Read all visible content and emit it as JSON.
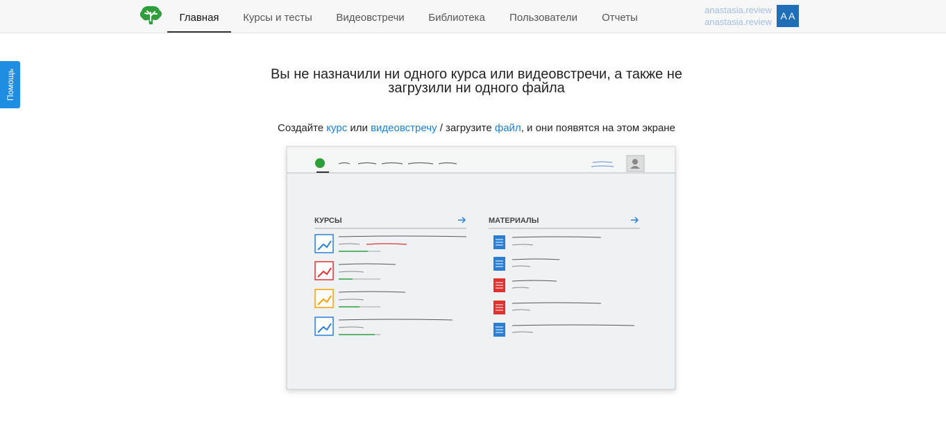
{
  "nav": {
    "items": [
      {
        "label": "Главная",
        "active": true
      },
      {
        "label": "Курсы и тесты",
        "active": false
      },
      {
        "label": "Видеовстречи",
        "active": false
      },
      {
        "label": "Библиотека",
        "active": false
      },
      {
        "label": "Пользователи",
        "active": false
      },
      {
        "label": "Отчеты",
        "active": false
      }
    ]
  },
  "user": {
    "links": [
      "anastasia.review",
      "anastasia.review"
    ],
    "avatar_initials": "A A"
  },
  "help": {
    "label": "Помощь"
  },
  "empty_state": {
    "title": "Вы не назначили ни одного курса или видеовстречи, а также не загрузили ни одного файла",
    "hint": {
      "t1": "Создайте ",
      "course_link": "курс",
      "t2": " или ",
      "meeting_link": "видеовстречу",
      "t3": " / загрузите ",
      "file_link": "файл",
      "t4": ", и они появятся на этом экране"
    }
  },
  "illustration": {
    "courses_title": "КУРСЫ",
    "materials_title": "МАТЕРИАЛЫ"
  },
  "colors": {
    "brand_green": "#2e9e3a",
    "accent_blue": "#1a7fd4",
    "help_tab": "#1f8ee0",
    "avatar_bg": "#1f6fb8"
  }
}
